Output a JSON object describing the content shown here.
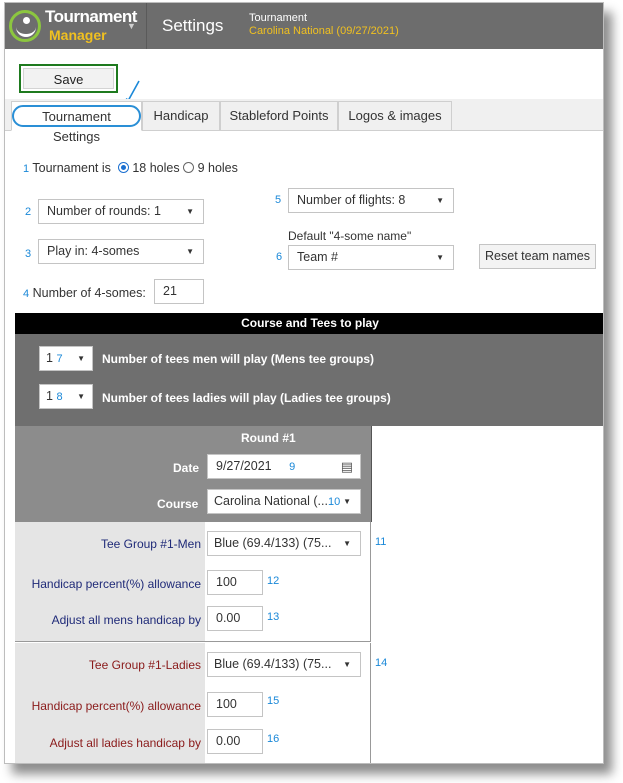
{
  "header": {
    "logo_title": "Tournament",
    "logo_subtitle": "Manager",
    "page": "Settings",
    "tournament_label": "Tournament",
    "tournament_name": "Carolina National (09/27/2021)"
  },
  "toolbar": {
    "save_label": "Save"
  },
  "tabs": [
    {
      "label": "Tournament Settings"
    },
    {
      "label": "Handicap"
    },
    {
      "label": "Stableford Points"
    },
    {
      "label": "Logos & images"
    }
  ],
  "settings": {
    "n1": "1",
    "tournament_is": "Tournament is",
    "holes18": "18 holes",
    "holes9": "9 holes",
    "n2": "2",
    "rounds": "Number of rounds: 1",
    "n3": "3",
    "play_in": "Play in: 4-somes",
    "n4": "4",
    "foursomes_label": "Number of 4-somes:",
    "foursomes_value": "21",
    "n5": "5",
    "flights": "Number of flights: 8",
    "default_name_label": "Default \"4-some name\"",
    "n6": "6",
    "team_name": "Team #",
    "reset_label": "Reset team names"
  },
  "course": {
    "title": "Course and Tees to play",
    "men_tees_value": "1",
    "men_tees_num": "7",
    "men_tees_label": "Number of tees men will play (Mens tee groups)",
    "ladies_tees_value": "1",
    "ladies_tees_num": "8",
    "ladies_tees_label": "Number of tees ladies will play (Ladies tee groups)"
  },
  "round": {
    "title": "Round #1",
    "date_label": "Date",
    "date_value": "9/27/2021",
    "n9": "9",
    "course_label": "Course",
    "course_value": "Carolina National (...",
    "n10": "10"
  },
  "men": {
    "tee_group_label": "Tee Group #1-Men",
    "tee_value": "Blue (69.4/133) (75...",
    "n11": "11",
    "hcp_label": "Handicap percent(%) allowance",
    "hcp_value": "100",
    "n12": "12",
    "adjust_label": "Adjust all mens handicap by",
    "adjust_value": "0.00",
    "n13": "13"
  },
  "ladies": {
    "tee_group_label": "Tee Group #1-Ladies",
    "tee_value": "Blue (69.4/133) (75...",
    "n14": "14",
    "hcp_label": "Handicap percent(%) allowance",
    "hcp_value": "100",
    "n15": "15",
    "adjust_label": "Adjust all ladies handicap by",
    "adjust_value": "0.00",
    "n16": "16"
  },
  "colors": {
    "header_bg": "#6d6d6d",
    "accent_yellow": "#f0c020",
    "logo_green": "#8cc63f",
    "save_border": "#1e7a1e",
    "callout_blue": "#1a88d8",
    "men_text": "#1f2a78",
    "ladies_text": "#8a1a1a"
  }
}
